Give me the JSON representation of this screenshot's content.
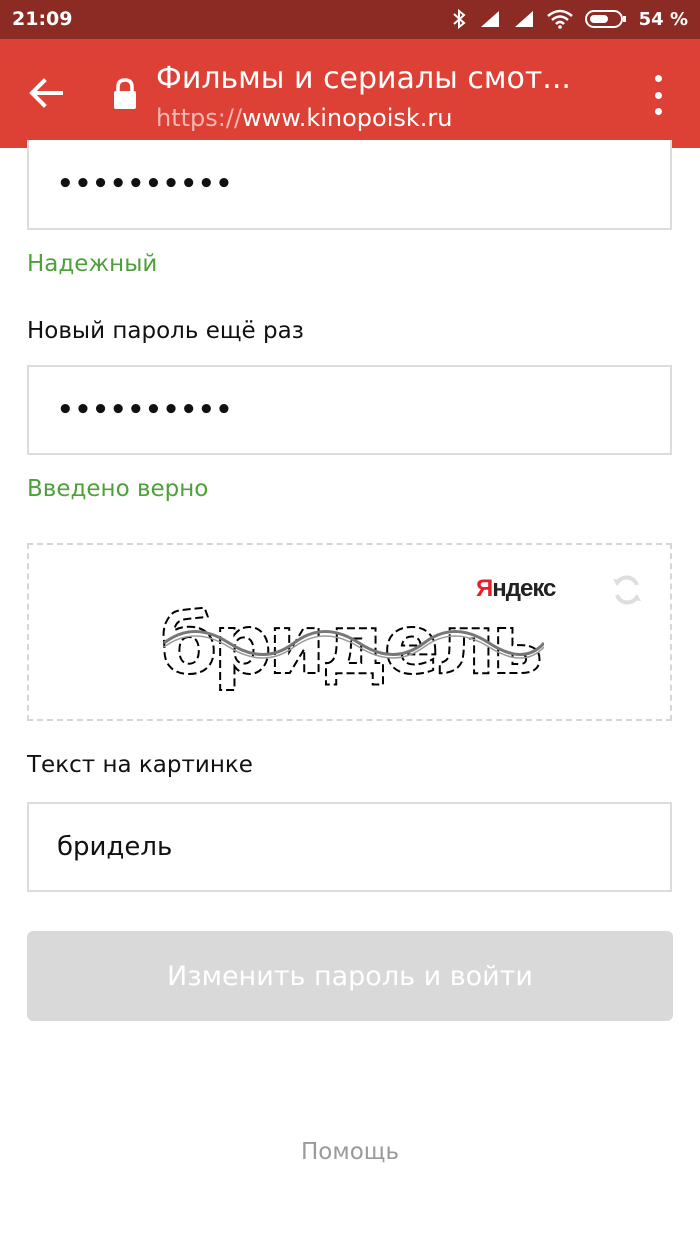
{
  "status_bar": {
    "time": "21:09",
    "battery_percent": "54 %"
  },
  "browser": {
    "title": "Фильмы и сериалы смот...",
    "url_scheme": "https://",
    "url_host": "www.kinopoisk.ru",
    "icons": {
      "back": "arrow-back-icon",
      "lock": "lock-icon",
      "menu": "more-vert-icon"
    }
  },
  "form": {
    "new_password": {
      "value": "••••••••••",
      "strength": "Надежный"
    },
    "repeat_password": {
      "label": "Новый пароль ещё раз",
      "value": "••••••••••",
      "status": "Введено верно"
    },
    "captcha": {
      "brand_first": "Я",
      "brand_rest": "ндекс",
      "image_text": "бридель",
      "label": "Текст на картинке",
      "value": "бридель"
    },
    "submit_label": "Изменить пароль и войти",
    "help_label": "Помощь"
  },
  "colors": {
    "toolbar": "#dd4136",
    "status_bar": "#8c2b23",
    "hint_green": "#4ea03b",
    "button_disabled": "#d9d9d9"
  }
}
